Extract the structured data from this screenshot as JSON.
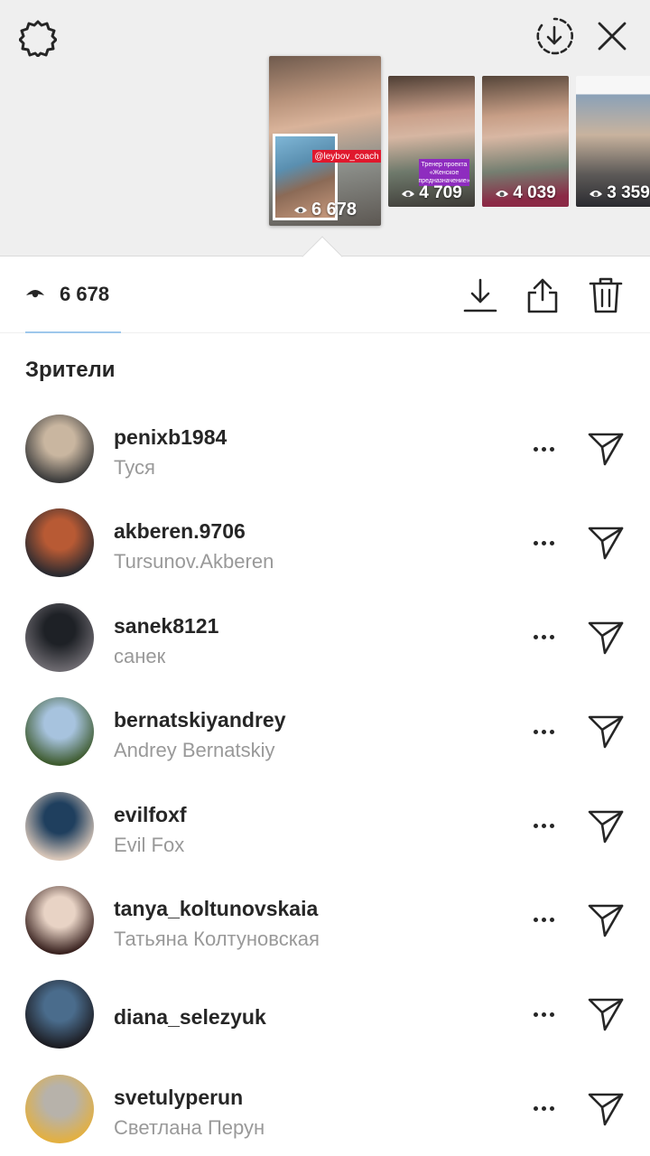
{
  "stories": [
    {
      "views": "6 678",
      "tag": "@leybov_coach",
      "selected": true
    },
    {
      "views": "4 709",
      "tag": "Тренер проекта «Женское предназначение»"
    },
    {
      "views": "4 039"
    },
    {
      "views": "3 359"
    }
  ],
  "stats": {
    "views": "6 678"
  },
  "viewers_section": {
    "title": "Зрители"
  },
  "viewers": [
    {
      "username": "penixb1984",
      "fullname": "Туся",
      "avatar": [
        "#c9b6a0",
        "#3b3b3b"
      ]
    },
    {
      "username": "akberen.9706",
      "fullname": "Tursunov.Akberen",
      "avatar": [
        "#b85a34",
        "#2a2a30"
      ]
    },
    {
      "username": "sanek8121",
      "fullname": "санек",
      "avatar": [
        "#1e2126",
        "#6d6a70"
      ]
    },
    {
      "username": "bernatskiyandrey",
      "fullname": "Andrey Bernatskiy",
      "avatar": [
        "#a7c3de",
        "#3e5b2f"
      ]
    },
    {
      "username": "evilfoxf",
      "fullname": "Evil Fox",
      "avatar": [
        "#1f3f5e",
        "#d9c7b9"
      ]
    },
    {
      "username": "tanya_koltunovskaia",
      "fullname": "Татьяна Колтуновская",
      "avatar": [
        "#e8d3c5",
        "#3a2320"
      ]
    },
    {
      "username": "diana_selezyuk",
      "fullname": "",
      "avatar": [
        "#4a6c8c",
        "#1c1c22"
      ]
    },
    {
      "username": "svetulyperun",
      "fullname": "Светлана Перун",
      "avatar": [
        "#b7b2aa",
        "#e3b040"
      ]
    }
  ]
}
